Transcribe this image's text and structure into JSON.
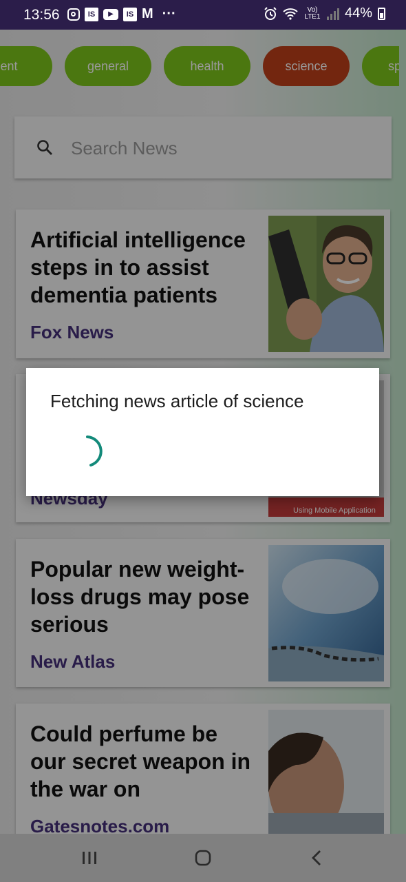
{
  "status_bar": {
    "time": "13:56",
    "battery": "44%",
    "network_label": "Vo) LTE1",
    "left_icons": [
      "instagram-icon",
      "is-app-icon",
      "youtube-icon",
      "is-app-icon",
      "gmail-icon",
      "more-dots-icon"
    ],
    "right_icons": [
      "alarm-icon",
      "wifi-icon",
      "signal-icon",
      "battery-icon"
    ],
    "more": "···"
  },
  "categories": [
    {
      "label": "ent",
      "active": false
    },
    {
      "label": "general",
      "active": false
    },
    {
      "label": "health",
      "active": false
    },
    {
      "label": "science",
      "active": true
    },
    {
      "label": "sport",
      "active": false
    }
  ],
  "search": {
    "placeholder": "Search News"
  },
  "articles": [
    {
      "title": "Artificial intelligence steps in to assist dementia patients",
      "source": "Fox News"
    },
    {
      "title": "",
      "source": "Newsday"
    },
    {
      "title": "Popular new weight-loss drugs may pose serious",
      "source": "New Atlas"
    },
    {
      "title": "Could perfume be our secret weapon in the war on",
      "source": "Gatesnotes.com"
    }
  ],
  "partial_banner_text": "Using Mobile Application",
  "dialog": {
    "message": "Fetching news article of science"
  },
  "colors": {
    "chip": "#7ec61c",
    "chip_active": "#c0401a",
    "source_text": "#45307a",
    "spinner": "#138a7a",
    "status_bar": "#2b1d4a"
  }
}
